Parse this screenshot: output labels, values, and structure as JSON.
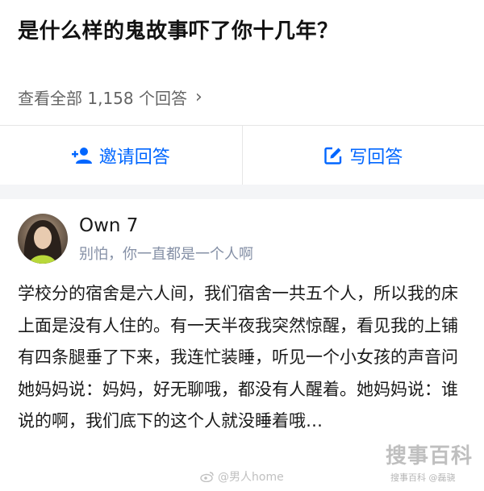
{
  "question": {
    "title": "是什么样的鬼故事吓了你十几年？",
    "view_all_label": "查看全部 1,158 个回答"
  },
  "actions": {
    "invite_label": "邀请回答",
    "write_label": "写回答",
    "accent_color": "#0066ff"
  },
  "answer": {
    "author_name": "Own 7",
    "author_bio": "别怕，你一直都是一个人啊",
    "content": "学校分的宿舍是六人间，我们宿舍一共五个人，所以我的床上面是没有人住的。有一天半夜我突然惊醒，看见我的上铺有四条腿垂了下来，我连忙装睡，听见一个小女孩的声音问她妈妈说：妈妈，好无聊哦，都没有人醒着。她妈妈说：谁说的啊，我们底下的这个人就没睡着哦…"
  },
  "watermarks": {
    "weibo": "@男人home",
    "logo": "搜事百科",
    "credit": "搜事百科 @磊骁"
  }
}
